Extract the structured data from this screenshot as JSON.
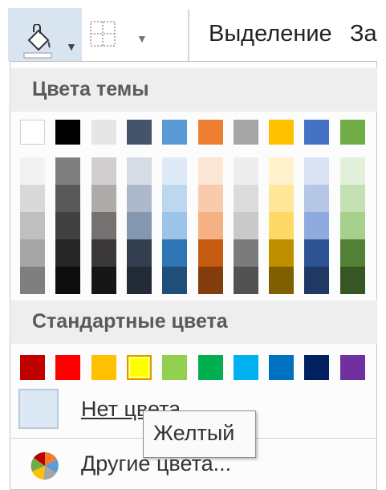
{
  "ribbon": {
    "fill_button_icon": "paint-bucket-icon",
    "border_button_icon": "borders-icon",
    "select_label": "Выделение",
    "next_label": "За"
  },
  "theme_colors": {
    "header": "Цвета темы",
    "base": [
      "#ffffff",
      "#000000",
      "#e7e6e6",
      "#44546a",
      "#5b9bd5",
      "#ed7d31",
      "#a5a5a5",
      "#ffc000",
      "#4472c4",
      "#70ad47"
    ],
    "tints": [
      [
        "#f2f2f2",
        "#d9d9d9",
        "#bfbfbf",
        "#a6a6a6",
        "#7f7f7f"
      ],
      [
        "#7f7f7f",
        "#595959",
        "#404040",
        "#262626",
        "#0d0d0d"
      ],
      [
        "#d0cece",
        "#aeabab",
        "#757171",
        "#3a3838",
        "#171616"
      ],
      [
        "#d6dce4",
        "#adb9ca",
        "#8497b0",
        "#333f4f",
        "#222a35"
      ],
      [
        "#deebf6",
        "#bdd7ee",
        "#9dc3e6",
        "#2e75b5",
        "#1f4e79"
      ],
      [
        "#fbe5d5",
        "#f7cbac",
        "#f4b183",
        "#c55a11",
        "#833c0b"
      ],
      [
        "#ededed",
        "#dbdbdb",
        "#c9c9c9",
        "#7b7b7b",
        "#525252"
      ],
      [
        "#fff2cc",
        "#ffe699",
        "#ffd966",
        "#bf8f00",
        "#7f6000"
      ],
      [
        "#dae3f3",
        "#b4c7e7",
        "#8faadc",
        "#2f5496",
        "#1f3864"
      ],
      [
        "#e2efd9",
        "#c5e0b3",
        "#a8d08d",
        "#538135",
        "#375623"
      ]
    ]
  },
  "standard_colors": {
    "header": "Стандартные цвета",
    "colors": [
      "#c00000",
      "#ff0000",
      "#ffc000",
      "#ffff00",
      "#92d050",
      "#00b050",
      "#00b0f0",
      "#0070c0",
      "#002060",
      "#7030a0"
    ],
    "selected_index": 3
  },
  "menu": {
    "no_color_label": "Нет цвета",
    "more_colors_label": "Другие цвета..."
  },
  "tooltip": {
    "text": "Желтый"
  }
}
